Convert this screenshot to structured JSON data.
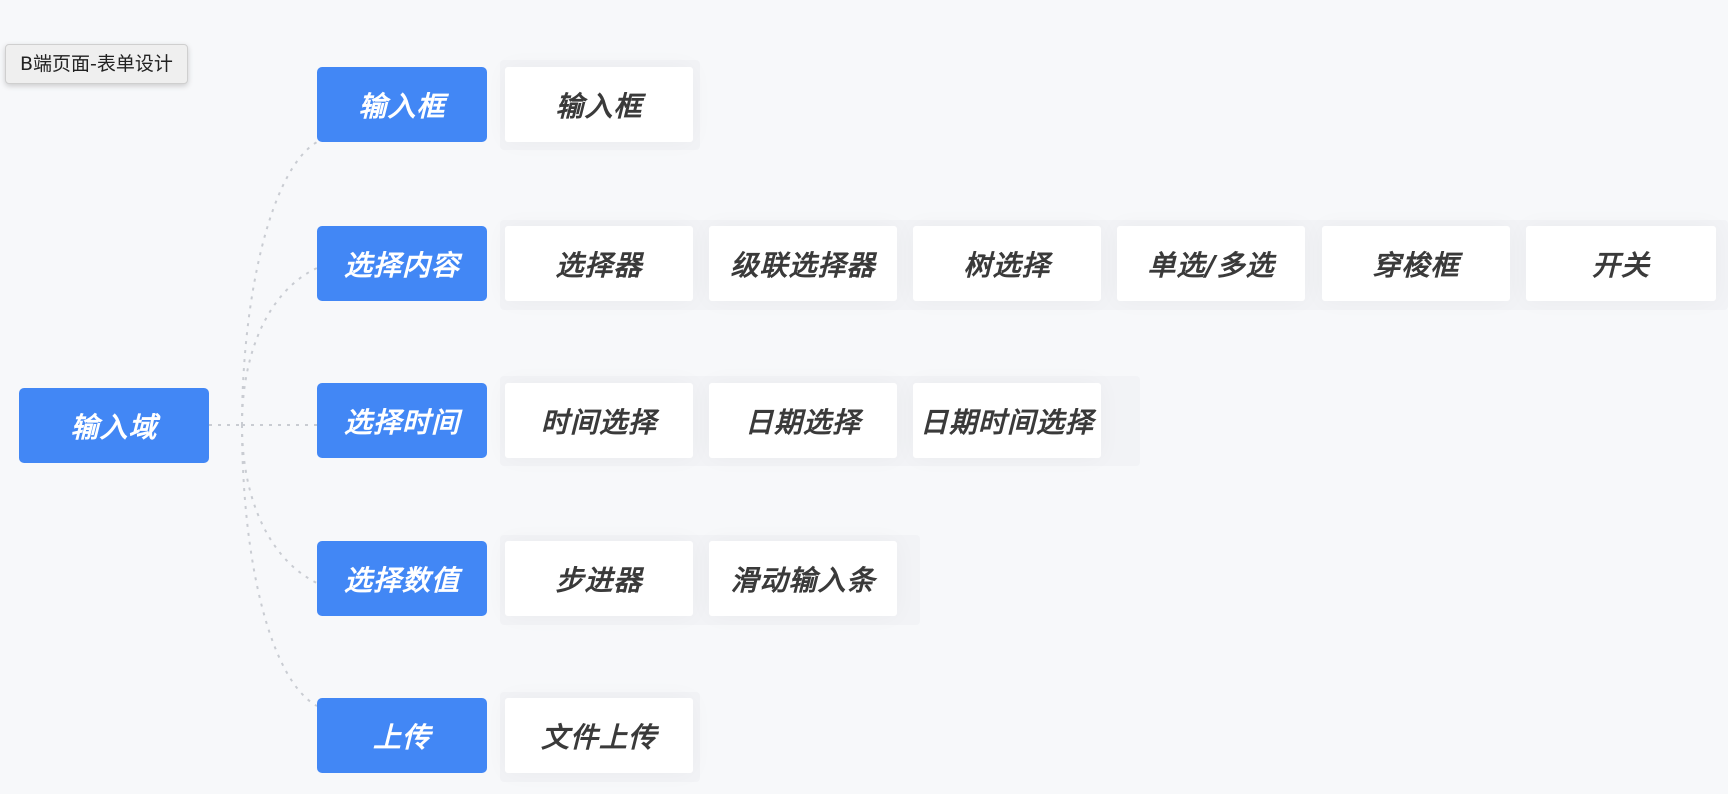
{
  "tooltip": {
    "text": "B端页面-表单设计"
  },
  "root": {
    "label": "输入域"
  },
  "categories": [
    {
      "label": "输入框",
      "items": [
        "输入框"
      ]
    },
    {
      "label": "选择内容",
      "items": [
        "选择器",
        "级联选择器",
        "树选择",
        "单选/多选",
        "穿梭框",
        "开关"
      ]
    },
    {
      "label": "选择时间",
      "items": [
        "时间选择",
        "日期选择",
        "日期时间选择"
      ]
    },
    {
      "label": "选择数值",
      "items": [
        "步进器",
        "滑动输入条"
      ]
    },
    {
      "label": "上传",
      "items": [
        "文件上传"
      ]
    }
  ],
  "colors": {
    "primary": "#4287f5",
    "background": "#f7f8fa",
    "leaf_bg": "#ffffff",
    "connector": "#c9ccd2"
  }
}
